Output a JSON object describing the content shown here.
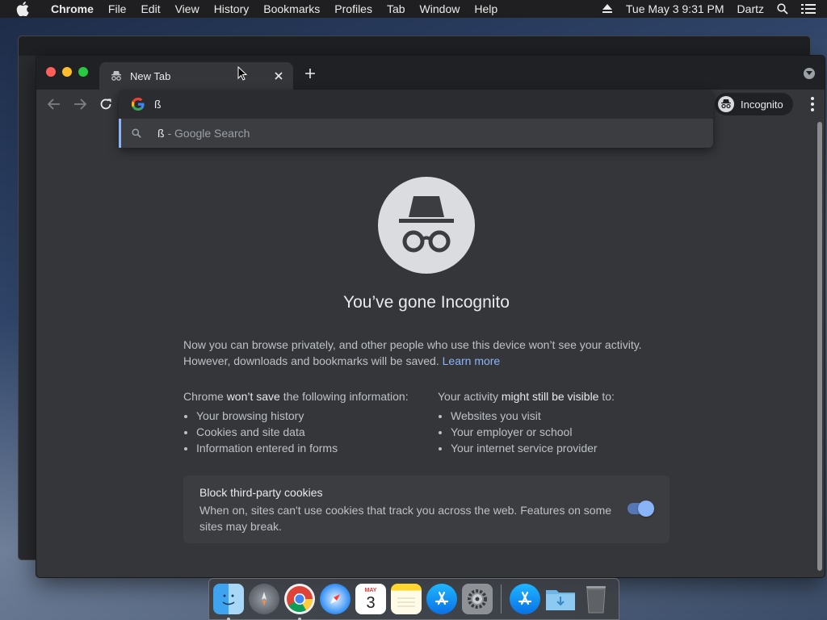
{
  "menubar": {
    "apple_icon": "apple-logo-icon",
    "items": [
      "Chrome",
      "File",
      "Edit",
      "View",
      "History",
      "Bookmarks",
      "Profiles",
      "Tab",
      "Window",
      "Help"
    ],
    "datetime": "Tue May 3  9:31 PM",
    "user": "Dartz",
    "icons": [
      "eject-icon",
      "spotlight-search-icon",
      "list-icon"
    ]
  },
  "browser": {
    "tab": {
      "title": "New Tab",
      "icon": "incognito-icon"
    },
    "omnibox": {
      "value": "ß",
      "suggestion_query": "ß",
      "suggestion_separator": " - ",
      "suggestion_provider": "Google Search"
    },
    "profile_label": "Incognito"
  },
  "page": {
    "title": "You’ve gone Incognito",
    "intro_line1": "Now you can browse privately, and other people who use this device won’t see your activity.",
    "intro_line2": "However, downloads and bookmarks will be saved.",
    "learn_more": "Learn more",
    "left_heading_pre": "Chrome ",
    "left_heading_em": "won’t save",
    "left_heading_post": " the following information:",
    "left_items": [
      "Your browsing history",
      "Cookies and site data",
      "Information entered in forms"
    ],
    "right_heading_pre": "Your activity ",
    "right_heading_em": "might still be visible",
    "right_heading_post": " to:",
    "right_items": [
      "Websites you visit",
      "Your employer or school",
      "Your internet service provider"
    ],
    "cookies_title": "Block third-party cookies",
    "cookies_desc": "When on, sites can't use cookies that track you across the web. Features on some sites may break.",
    "cookies_enabled": true
  },
  "dock": {
    "apps": [
      "finder-icon",
      "launchpad-icon",
      "chrome-icon",
      "safari-icon",
      "calendar-icon",
      "notes-icon",
      "app-store-icon",
      "system-preferences-icon"
    ],
    "calendar_month": "MAY",
    "calendar_day": "3",
    "extras": [
      "app-store-folder-icon",
      "downloads-folder-icon",
      "trash-icon"
    ]
  },
  "colors": {
    "accent": "#8ab4f8",
    "window_bg": "#35363a",
    "tabstrip_bg": "#202124"
  }
}
